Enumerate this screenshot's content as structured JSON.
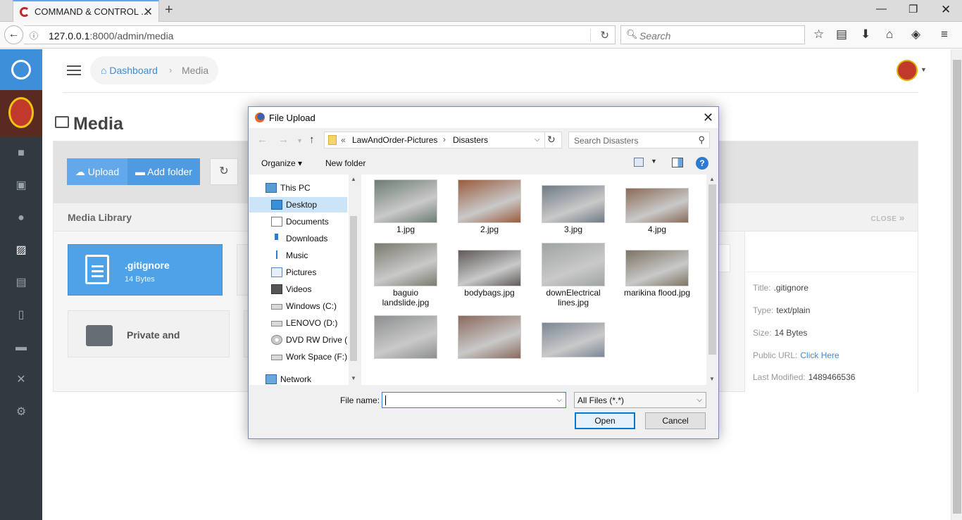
{
  "browser": {
    "tab_title": "COMMAND & CONTROL ...",
    "url_host": "127.0.0.1",
    "url_rest": ":8000/admin/media",
    "search_placeholder": "Search"
  },
  "header": {
    "breadcrumb_dashboard": "Dashboard",
    "breadcrumb_separator": "›",
    "breadcrumb_current": "Media"
  },
  "page": {
    "title": "Media",
    "upload_label": "Upload",
    "add_folder_label": "Add folder",
    "library_title": "Media Library",
    "close_label": "CLOSE",
    "cards": [
      {
        "name": ".gitignore",
        "size": "14 Bytes"
      },
      {
        "name": "Private and"
      }
    ],
    "details": [
      {
        "label": "Title:",
        "value": ".gitignore"
      },
      {
        "label": "Type:",
        "value": "text/plain"
      },
      {
        "label": "Size:",
        "value": "14 Bytes"
      },
      {
        "label": "Public URL:",
        "value": "Click Here"
      },
      {
        "label": "Last Modified:",
        "value": "1489466536"
      }
    ]
  },
  "dialog": {
    "title": "File Upload",
    "path_prefix": "«",
    "path_parent": "LawAndOrder-Pictures",
    "path_sep": "›",
    "path_current": "Disasters",
    "search_placeholder": "Search Disasters",
    "organize_label": "Organize ▾",
    "new_folder_label": "New folder",
    "tree": [
      {
        "label": "This PC",
        "icon": "pc-icon"
      },
      {
        "label": "Desktop",
        "icon": "desktop-icon",
        "selected": true
      },
      {
        "label": "Documents",
        "icon": "documents-icon"
      },
      {
        "label": "Downloads",
        "icon": "downloads-icon"
      },
      {
        "label": "Music",
        "icon": "music-icon"
      },
      {
        "label": "Pictures",
        "icon": "pictures-icon"
      },
      {
        "label": "Videos",
        "icon": "videos-icon"
      },
      {
        "label": "Windows (C:)",
        "icon": "drive-icon"
      },
      {
        "label": "LENOVO (D:)",
        "icon": "drive-icon"
      },
      {
        "label": "DVD RW Drive (E",
        "icon": "dvd-icon"
      },
      {
        "label": "Work Space (F:)",
        "icon": "drive-icon"
      },
      {
        "label": "Network",
        "icon": "network-icon"
      }
    ],
    "files": [
      {
        "name": "1.jpg",
        "color": "#6d7d73"
      },
      {
        "name": "2.jpg",
        "color": "#9a5c3e"
      },
      {
        "name": "3.jpg",
        "color": "#6f7b86"
      },
      {
        "name": "4.jpg",
        "color": "#8a6b58"
      },
      {
        "name": "baguio landslide.jpg",
        "color": "#7b7a6e"
      },
      {
        "name": "bodybags.jpg",
        "color": "#5f5a58"
      },
      {
        "name": "downElectrical lines.jpg",
        "color": "#9ea4a2"
      },
      {
        "name": "marikina flood.jpg",
        "color": "#7d7463"
      },
      {
        "name": "",
        "color": "#8d8f90"
      },
      {
        "name": "",
        "color": "#8a6a5c"
      },
      {
        "name": "",
        "color": "#7b8794"
      }
    ],
    "filename_label": "File name:",
    "filename_value": "",
    "filetype_value": "All Files (*.*)",
    "open_label": "Open",
    "cancel_label": "Cancel"
  }
}
